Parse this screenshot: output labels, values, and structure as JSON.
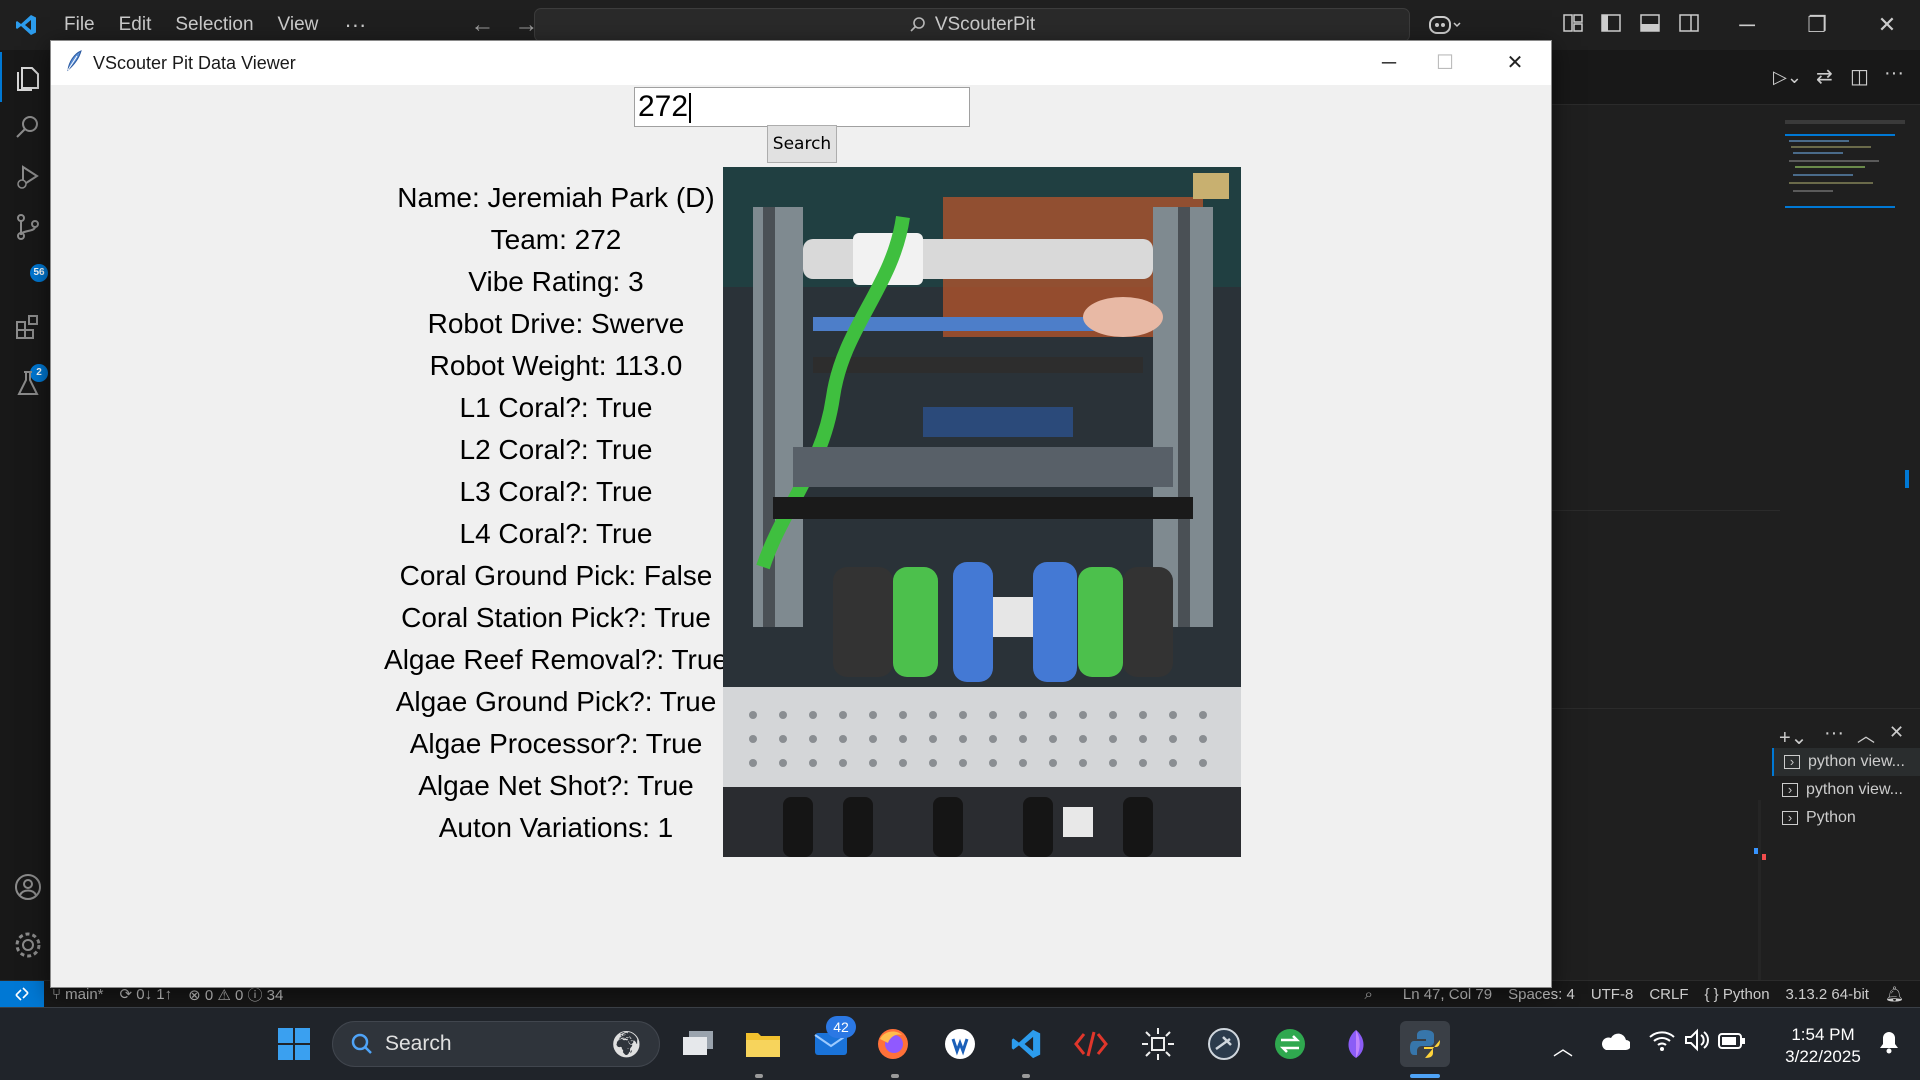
{
  "vscode": {
    "menu": [
      "File",
      "Edit",
      "Selection",
      "View"
    ],
    "more": "···",
    "search_title": "VScouterPit",
    "badges": {
      "source_control": "56",
      "extensions": "2"
    },
    "terminals": [
      "python view...",
      "python view...",
      "Python"
    ],
    "status": {
      "branch": "main*",
      "sync": "0↓ 1↑",
      "problems": "⊗ 0 ⚠ 0 ⓘ 34",
      "position": "Ln 47, Col 79",
      "spaces": "Spaces: 4",
      "encoding": "UTF-8",
      "eol": "CRLF",
      "language": "{ } Python",
      "interpreter": "3.13.2 64-bit"
    }
  },
  "app": {
    "title": "VScouter Pit Data Viewer",
    "search_value": "272",
    "search_button": "Search",
    "fields": [
      "Name: Jeremiah Park (D)",
      "Team: 272",
      "Vibe Rating: 3",
      "Robot Drive: Swerve",
      "Robot Weight: 113.0",
      "L1 Coral?: True",
      "L2 Coral?: True",
      "L3 Coral?: True",
      "L4 Coral?: True",
      "Coral Ground Pick: False",
      "Coral Station Pick?: True",
      "Algae Reef Removal?: True",
      "Algae Ground Pick?: True",
      "Algae Processor?: True",
      "Algae Net Shot?: True",
      "Auton Variations: 1"
    ]
  },
  "taskbar": {
    "search_placeholder": "Search",
    "mail_badge": "42",
    "time": "1:54 PM",
    "date": "3/22/2025"
  },
  "colors": {
    "accent": "#0078d4",
    "vscode_bg": "#1f1f1f",
    "app_bg": "#f0f0f0",
    "taskbar_bg": "#20242a"
  }
}
